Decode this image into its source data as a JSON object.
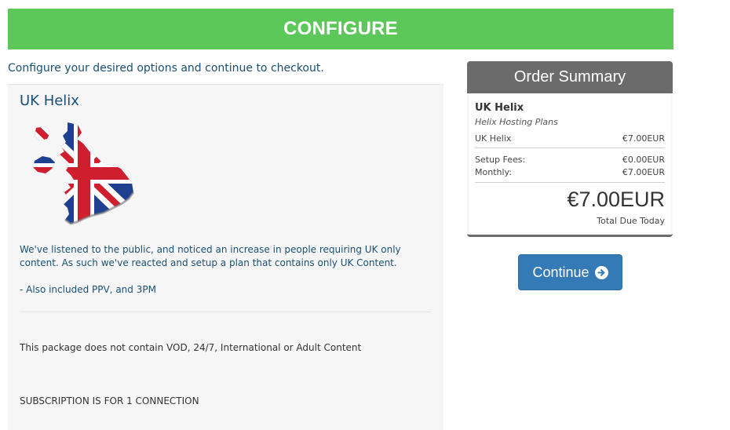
{
  "header": {
    "title": "CONFIGURE"
  },
  "intro": {
    "text": "Configure your desired options and continue to checkout."
  },
  "product": {
    "name": "UK Helix",
    "description_line1": "We've listened to the public, and noticed an increase in people requiring UK only content. As such we've reacted and setup a plan that contains only UK Content.",
    "description_line2": "- Also included PPV, and 3PM",
    "note": "This package does not contain VOD, 24/7, International or Adult Content",
    "connection_note": "SUBSCRIPTION IS FOR 1 CONNECTION"
  },
  "summary": {
    "title": "Order Summary",
    "product_name": "UK Helix",
    "product_group": "Helix Hosting Plans",
    "items": [
      {
        "label": "UK Helix",
        "value": "€7.00EUR"
      }
    ],
    "fees": [
      {
        "label": "Setup Fees:",
        "value": "€0.00EUR"
      },
      {
        "label": "Monthly:",
        "value": "€7.00EUR"
      }
    ],
    "total": "€7.00EUR",
    "total_label": "Total Due Today"
  },
  "actions": {
    "continue_label": "Continue",
    "continue_icon": "arrow-circle-right-icon"
  },
  "colors": {
    "header_green": "#5cc85a",
    "summary_gray": "#6b6b6b",
    "button_blue": "#337ab7",
    "text_blue": "#1a4f73"
  }
}
